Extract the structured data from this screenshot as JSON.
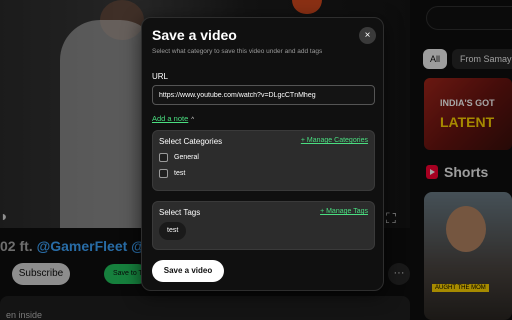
{
  "background": {
    "video_title_prefix": "02 ft.",
    "video_title_tag1": "@GamerFleet",
    "video_title_tag2": "@Joke",
    "subscribe_label": "Subscribe",
    "save_to_label": "Save to T",
    "more_label": "···",
    "description_snippet": "en inside",
    "chips": {
      "all": "All",
      "from": "From Samay R"
    },
    "thumb1": {
      "line1": "INDIA'S GOT",
      "line2": "LATENT"
    },
    "shorts_label": "Shorts",
    "thumb2_caption": "AUGHT THE MOM"
  },
  "modal": {
    "title": "Save a video",
    "close_label": "×",
    "subtitle": "Select what category to save this video under and add tags",
    "url_label": "URL",
    "url_value": "https://www.youtube.com/watch?v=DLgcCTnMheg",
    "add_note_label": "Add a note",
    "add_note_chevron": "^",
    "categories": {
      "title": "Select Categories",
      "manage_label": "+ Manage Categories",
      "items": [
        {
          "label": "General",
          "checked": false
        },
        {
          "label": "test",
          "checked": false
        }
      ]
    },
    "tags": {
      "title": "Select Tags",
      "manage_label": "+ Manage Tags",
      "items": [
        {
          "label": "test"
        }
      ]
    },
    "save_button_label": "Save a video"
  }
}
